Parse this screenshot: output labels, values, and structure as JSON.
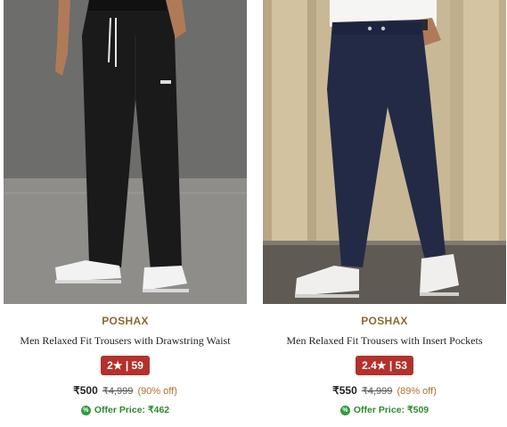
{
  "products": [
    {
      "brand": "POSHAX",
      "title": "Men Relaxed Fit Trousers with Drawstring Waist",
      "rating": "2★ | 59",
      "price": "₹500",
      "mrp": "₹4,999",
      "discount": "(90% off)",
      "offer_price": "Offer Price: ₹462"
    },
    {
      "brand": "POSHAX",
      "title": "Men Relaxed Fit Trousers with Insert Pockets",
      "rating": "2.4★ | 53",
      "price": "₹550",
      "mrp": "₹4,999",
      "discount": "(89% off)",
      "offer_price": "Offer Price: ₹509"
    }
  ],
  "colors": {
    "brand": "#8b6a2f",
    "rating_badge": "#b4312c",
    "offer_green": "#2d8a2d"
  }
}
